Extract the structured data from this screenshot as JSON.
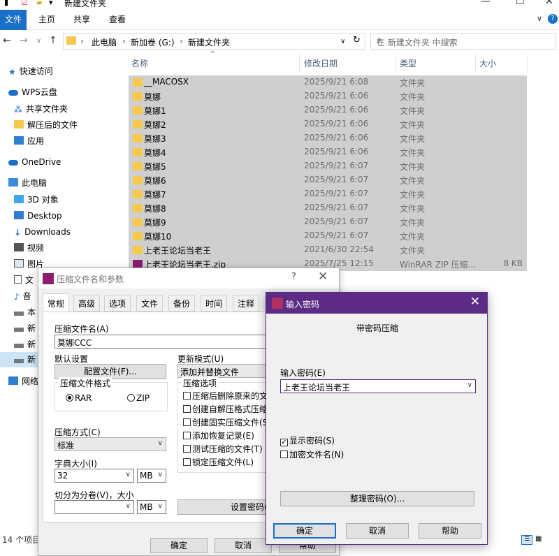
{
  "explorer": {
    "window_title": "新建文件夹",
    "ribbon_tabs": [
      "文件",
      "主页",
      "共享",
      "查看"
    ],
    "breadcrumb": [
      "此电脑",
      "新加卷 (G:)",
      "新建文件夹"
    ],
    "search_placeholder": "在 新建文件夹 中搜索",
    "sidebar": [
      {
        "label": "快速访问",
        "icon": "star-icon"
      },
      {
        "label": "WPS云盘",
        "icon": "cloud-icon"
      },
      {
        "label": "共享文件夹",
        "icon": "share-icon"
      },
      {
        "label": "解压后的文件",
        "icon": "folder-icon"
      },
      {
        "label": "应用",
        "icon": "apps-icon"
      },
      {
        "label": "OneDrive",
        "icon": "onedrive-icon"
      },
      {
        "label": "此电脑",
        "icon": "pc-icon"
      },
      {
        "label": "3D 对象",
        "icon": "cube-icon"
      },
      {
        "label": "Desktop",
        "icon": "desktop-icon"
      },
      {
        "label": "Downloads",
        "icon": "download-icon"
      },
      {
        "label": "视频",
        "icon": "video-icon"
      },
      {
        "label": "图片",
        "icon": "image-icon"
      },
      {
        "label": "文",
        "icon": "document-icon"
      },
      {
        "label": "音",
        "icon": "music-icon"
      },
      {
        "label": "本",
        "icon": "drive-icon"
      },
      {
        "label": "新",
        "icon": "drive-icon"
      },
      {
        "label": "新",
        "icon": "drive-icon"
      },
      {
        "label": "新",
        "icon": "drive-icon"
      },
      {
        "label": "网络",
        "icon": "network-icon"
      }
    ],
    "columns": {
      "name": "名称",
      "date": "修改日期",
      "type": "类型",
      "size": "大小"
    },
    "files": [
      {
        "name": "__MACOSX",
        "date": "2025/9/21 6:08",
        "type": "文件夹",
        "size": ""
      },
      {
        "name": "莫娜",
        "date": "2025/9/21 6:06",
        "type": "文件夹",
        "size": ""
      },
      {
        "name": "莫娜1",
        "date": "2025/9/21 6:06",
        "type": "文件夹",
        "size": ""
      },
      {
        "name": "莫娜2",
        "date": "2025/9/21 6:06",
        "type": "文件夹",
        "size": ""
      },
      {
        "name": "莫娜3",
        "date": "2025/9/21 6:06",
        "type": "文件夹",
        "size": ""
      },
      {
        "name": "莫娜4",
        "date": "2025/9/21 6:06",
        "type": "文件夹",
        "size": ""
      },
      {
        "name": "莫娜5",
        "date": "2025/9/21 6:07",
        "type": "文件夹",
        "size": ""
      },
      {
        "name": "莫娜6",
        "date": "2025/9/21 6:07",
        "type": "文件夹",
        "size": ""
      },
      {
        "name": "莫娜7",
        "date": "2025/9/21 6:07",
        "type": "文件夹",
        "size": ""
      },
      {
        "name": "莫娜8",
        "date": "2025/9/21 6:07",
        "type": "文件夹",
        "size": ""
      },
      {
        "name": "莫娜9",
        "date": "2025/9/21 6:07",
        "type": "文件夹",
        "size": ""
      },
      {
        "name": "莫娜10",
        "date": "2025/9/21 6:07",
        "type": "文件夹",
        "size": ""
      },
      {
        "name": "上老王论坛当老王",
        "date": "2021/6/30 22:54",
        "type": "文件夹",
        "size": ""
      },
      {
        "name": "上老王论坛当老王.zip",
        "date": "2025/7/25 12:15",
        "type": "WinRAR ZIP 压缩...",
        "size": "8 KB"
      }
    ],
    "status": "14 个项目"
  },
  "archive_dialog": {
    "title": "压缩文件名和参数",
    "help": "?",
    "tabs": [
      "常规",
      "高级",
      "选项",
      "文件",
      "备份",
      "时间",
      "注释"
    ],
    "archive_name_label": "压缩文件名(A)",
    "archive_name": "莫娜CCC",
    "default_settings_label": "默认设置",
    "profiles_button": "配置文件(F)...",
    "update_mode_label": "更新模式(U)",
    "update_mode": "添加并替换文件",
    "format_label": "压缩文件格式",
    "format_options": [
      "RAR",
      "ZIP"
    ],
    "options_label": "压缩选项",
    "options": [
      {
        "label": "压缩后删除原来的文",
        "checked": false
      },
      {
        "label": "创建自解压格式压缩",
        "checked": false
      },
      {
        "label": "创建固实压缩文件(S)",
        "checked": false
      },
      {
        "label": "添加恢复记录(E)",
        "checked": false
      },
      {
        "label": "测试压缩的文件(T)",
        "checked": false
      },
      {
        "label": "锁定压缩文件(L)",
        "checked": false
      }
    ],
    "method_label": "压缩方式(C)",
    "method": "标准",
    "dict_label": "字典大小(I)",
    "dict_value": "32",
    "dict_unit": "MB",
    "split_label": "切分为分卷(V)，大小",
    "split_value": "",
    "split_unit": "MB",
    "set_password_button": "设置密码(P)...",
    "ok": "确定",
    "cancel": "取消",
    "help_button": "帮助"
  },
  "password_dialog": {
    "title": "输入密码",
    "heading": "带密码压缩",
    "input_label": "输入密码(E)",
    "password": "上老王论坛当老王",
    "show_password": {
      "label": "显示密码(S)",
      "checked": true
    },
    "encrypt_names": {
      "label": "加密文件名(N)",
      "checked": false
    },
    "organize_button": "整理密码(O)...",
    "ok": "确定",
    "cancel": "取消",
    "help_button": "帮助"
  },
  "colors": {
    "accent": "#1a6fc9",
    "password_titlebar": "#5b2b86",
    "selection": "#cfcfcf",
    "folder": "#f6c94e"
  }
}
